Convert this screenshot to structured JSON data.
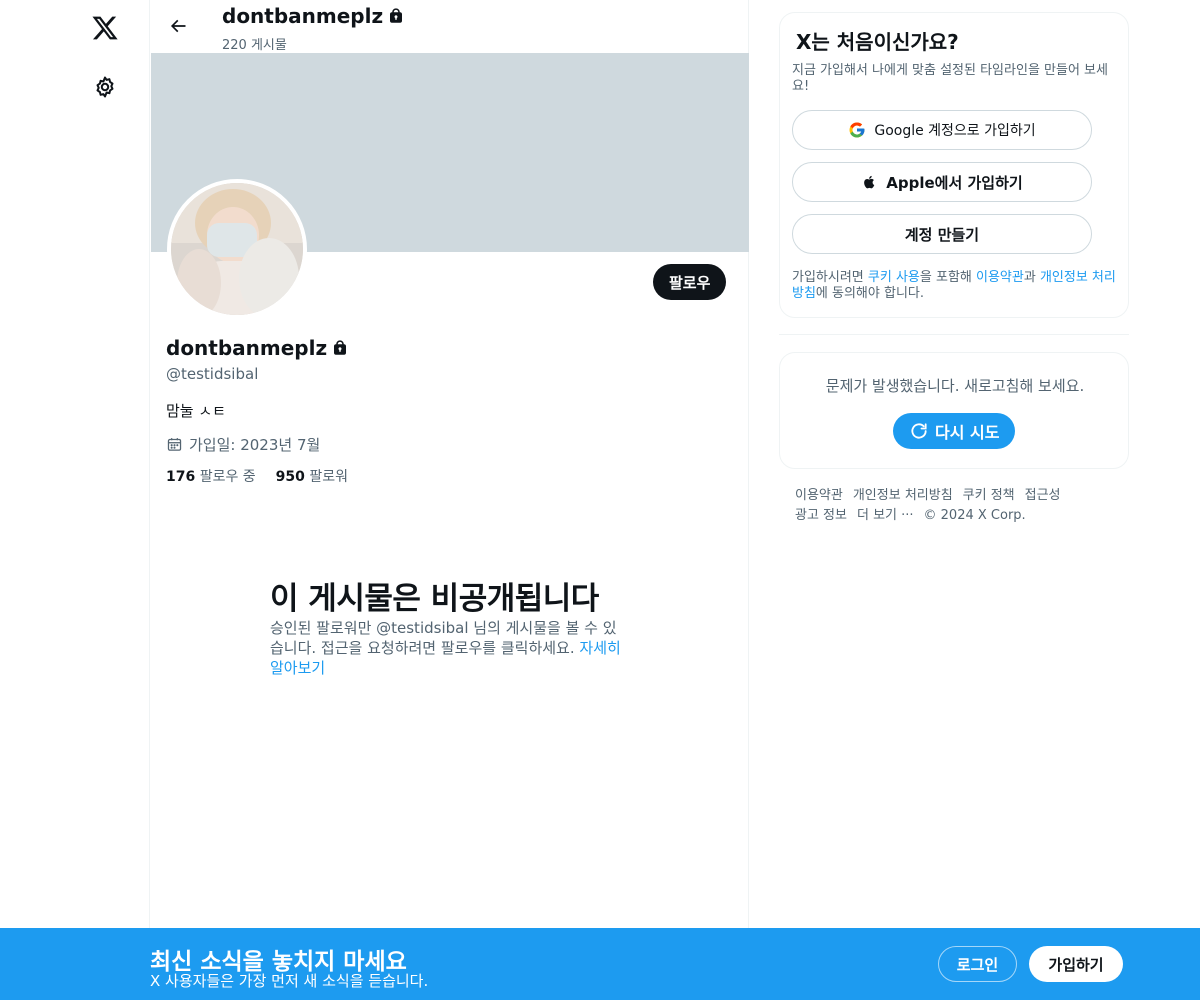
{
  "nav": {
    "logo_icon": "x-logo-icon",
    "settings_icon": "gear-icon"
  },
  "header": {
    "display_name": "dontbanmeplz",
    "post_count": "220 게시물"
  },
  "profile": {
    "display_name": "dontbanmeplz",
    "handle": "@testidsibal",
    "bio": "맘눌 ㅅㅌ",
    "joined": "가입일: 2023년 7월",
    "following_count": "176",
    "following_label": "팔로우 중",
    "followers_count": "950",
    "followers_label": "팔로워",
    "follow_button": "팔로우",
    "banner_color": "#cfd9de"
  },
  "private_notice": {
    "title": "이 게시물은 비공개됩니다",
    "description": "승인된 팔로워만 @testidsibal 님의 게시물을 볼 수 있습니다. 접근을 요청하려면 팔로우를 클릭하세요. ",
    "link": "자세히 알아보기"
  },
  "signup_card": {
    "title": "X는 처음이신가요?",
    "subtitle": "지금 가입해서 나에게 맞춤 설정된 타임라인을 만들어 보세요!",
    "google_button": "Google 계정으로 가입하기",
    "apple_button": "Apple에서 가입하기",
    "create_button": "계정 만들기",
    "terms_prefix": "가입하시려면 ",
    "terms_cookie": "쿠키 사용",
    "terms_mid1": "을 포함해 ",
    "terms_tos": "이용약관",
    "terms_mid2": "과 ",
    "terms_privacy": "개인정보 처리방침",
    "terms_suffix": "에 동의해야 합니다."
  },
  "error_card": {
    "message": "문제가 발생했습니다. 새로고침해 보세요.",
    "retry_button": "다시 시도"
  },
  "footer": {
    "links": [
      "이용약관",
      "개인정보 처리방침",
      "쿠키 정책",
      "접근성",
      "광고 정보",
      "더 보기 ···"
    ],
    "copyright": "© 2024 X Corp."
  },
  "bottom_bar": {
    "title": "최신 소식을 놓치지 마세요",
    "subtitle": "X 사용자들은 가장 먼저 새 소식을 듣습니다.",
    "login_button": "로그인",
    "signup_button": "가입하기",
    "background": "#1d9bf0"
  },
  "colors": {
    "accent": "#1d9bf0",
    "text_primary": "#0f1419",
    "text_secondary": "#536471"
  }
}
